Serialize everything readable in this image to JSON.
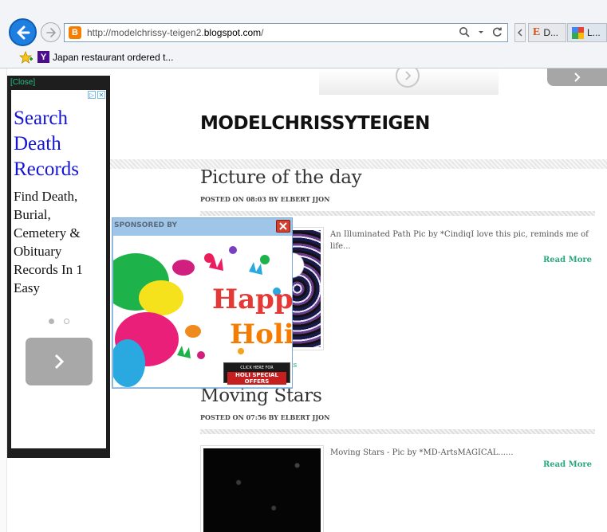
{
  "browser": {
    "url_prefix": "http://modelchrissy-teigen2.",
    "url_host": "blogspot.com",
    "url_suffix": "/",
    "tabs": [
      {
        "label": "D..."
      },
      {
        "label": "L..."
      }
    ],
    "favorites": [
      {
        "label": "Japan restaurant ordered t..."
      }
    ]
  },
  "site": {
    "title": "MODELCHRISSYTEIGEN"
  },
  "posts": [
    {
      "title": "Picture of the day",
      "meta": "POSTED ON 08:03 BY ELBERT JJON",
      "excerpt": "An Illuminated Path Pic by *CindiqI love this pic, reminds me of life...",
      "read_more": "Read More",
      "comments": "ts"
    },
    {
      "title": "Moving Stars",
      "meta": "POSTED ON 07:56 BY ELBERT JJON",
      "excerpt": "Moving Stars -   Pic by *MD-ArtsMAGICAL......",
      "read_more": "Read More"
    }
  ],
  "side_ad": {
    "close": "[Close]",
    "headline": "Search Death Records",
    "body": "Find Death, Burial, Cemetery & Obituary Records In 1 Easy",
    "active_slide": 1,
    "slide_count": 2
  },
  "sponsored": {
    "label": "SPONSORED BY",
    "happy": "Happy",
    "holi": "Holi",
    "cta_small": "CLICK HERE FOR",
    "cta_big": "HOLI SPECIAL OFFERS"
  },
  "colors": {
    "accent_green": "#2aa87b",
    "ad_link_blue": "#1515d6",
    "browser_back_blue": "#1f7fe0"
  }
}
